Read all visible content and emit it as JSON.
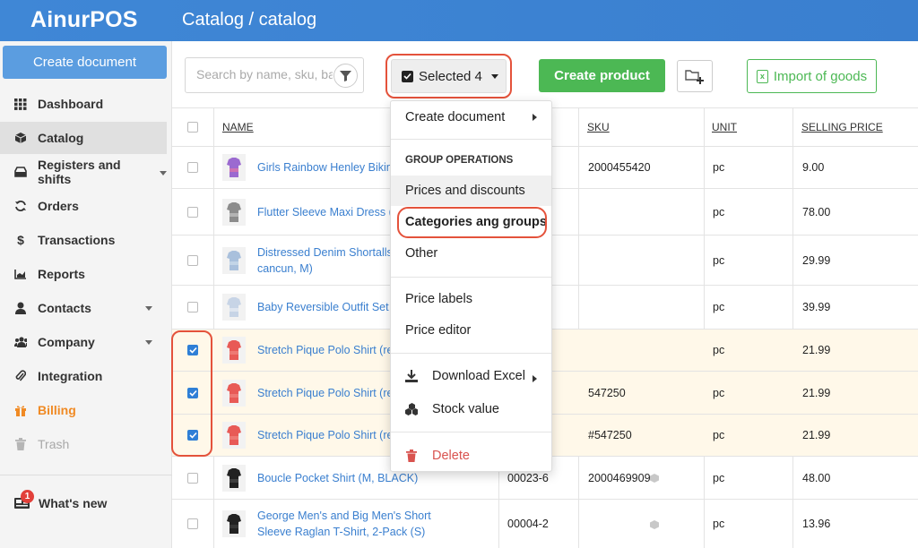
{
  "app": {
    "name": "AinurPOS",
    "breadcrumb": "Catalog / catalog"
  },
  "sidebar": {
    "create_document": "Create document",
    "items": [
      {
        "label": "Dashboard",
        "icon": "grid-icon"
      },
      {
        "label": "Catalog",
        "icon": "box-icon"
      },
      {
        "label": "Registers and shifts",
        "icon": "register-icon"
      },
      {
        "label": "Orders",
        "icon": "refresh-icon"
      },
      {
        "label": "Transactions",
        "icon": "dollar-icon"
      },
      {
        "label": "Reports",
        "icon": "chart-icon"
      },
      {
        "label": "Contacts",
        "icon": "user-icon"
      },
      {
        "label": "Company",
        "icon": "users-icon"
      },
      {
        "label": "Integration",
        "icon": "paperclip-icon"
      },
      {
        "label": "Billing",
        "icon": "gift-icon"
      },
      {
        "label": "Trash",
        "icon": "trash-icon"
      }
    ],
    "whats_new": {
      "label": "What's new",
      "badge": "1"
    }
  },
  "toolbar": {
    "search_placeholder": "Search by name, sku, barcode",
    "selected_label": "Selected 4",
    "create_product": "Create product",
    "import_goods": "Import of goods"
  },
  "menu": {
    "create_document": "Create document",
    "group_operations_header": "GROUP OPERATIONS",
    "prices_discounts": "Prices and discounts",
    "categories_groups": "Categories ang groups",
    "other": "Other",
    "price_labels": "Price labels",
    "price_editor": "Price editor",
    "download_excel": "Download Excel",
    "stock_value": "Stock value",
    "delete": "Delete"
  },
  "table": {
    "headers": {
      "name": "NAME",
      "sku": "SKU",
      "unit": "UNIT",
      "selling_price": "SELLING PRICE"
    },
    "rows": [
      {
        "name": "Girls Rainbow Henley Bikini S",
        "code": "",
        "sku": "2000455420",
        "unit": "pc",
        "price": "9.00",
        "checked": false
      },
      {
        "name": "Flutter Sleeve Maxi Dress (m floral, M)",
        "code": "",
        "sku": "",
        "unit": "pc",
        "price": "78.00",
        "checked": false
      },
      {
        "name": "Distressed Denim Shortalls (light cancun, M)",
        "code": "",
        "sku": "",
        "unit": "pc",
        "price": "29.99",
        "checked": false
      },
      {
        "name": "Baby Reversible Outfit Set (p",
        "code": "",
        "sku": "",
        "unit": "pc",
        "price": "39.99",
        "checked": false
      },
      {
        "name": "Stretch Pique Polo Shirt (rec",
        "code": "",
        "sku": "",
        "unit": "pc",
        "price": "21.99",
        "checked": true
      },
      {
        "name": "Stretch Pique Polo Shirt (rec",
        "code": "",
        "sku": "547250",
        "unit": "pc",
        "price": "21.99",
        "checked": true
      },
      {
        "name": "Stretch Pique Polo Shirt (rec",
        "code": "",
        "sku": "#547250",
        "unit": "pc",
        "price": "21.99",
        "checked": true
      },
      {
        "name": "Boucle Pocket Shirt (M, BLACK)",
        "code": "00023-6",
        "sku": "2000469909",
        "unit": "pc",
        "price": "48.00",
        "checked": false
      },
      {
        "name": "George Men's and Big Men's Short Sleeve Raglan T-Shirt, 2-Pack (S)",
        "code": "00004-2",
        "sku": "",
        "unit": "pc",
        "price": "13.96",
        "checked": false
      }
    ]
  },
  "colors": {
    "header": "#3f87d6",
    "accent_green": "#4cb854",
    "highlight": "#e4523b",
    "link": "#3a7fcf"
  }
}
